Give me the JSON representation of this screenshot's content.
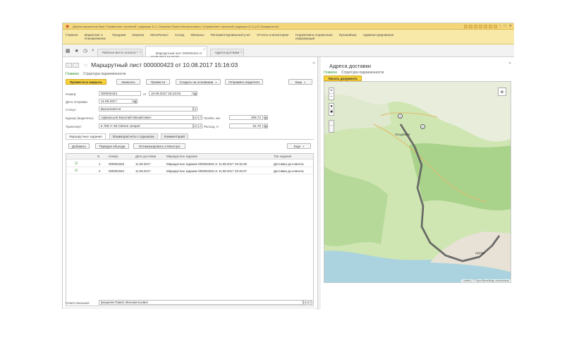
{
  "app": {
    "title": "Демонстрационная база \"Управление торговлей\", редакция 11.1 / Бакшеев Павел Иннокентьевич / (Управление торговлей, редакция 11.1) (1С:Предприятие)"
  },
  "sections": [
    {
      "label": "Главное"
    },
    {
      "label": "Маркетинг и\nпланирование"
    },
    {
      "label": "Продажи"
    },
    {
      "label": "Закупки"
    },
    {
      "label": "МегаПолист"
    },
    {
      "label": "Склад"
    },
    {
      "label": "Финансы"
    },
    {
      "label": "Регламентированный учет"
    },
    {
      "label": "Отчеты и мониторинг"
    },
    {
      "label": "Нормативно-справочная\nинформация"
    },
    {
      "label": "Органайзер"
    },
    {
      "label": "Администрирование"
    }
  ],
  "open_tabs": [
    {
      "label": "Рабочее место логиста *"
    },
    {
      "label": "Маршрутный лист 000000423 от\n10.08.2017 15:16:03"
    },
    {
      "label": "Адреса доставки"
    }
  ],
  "doc": {
    "title": "Маршрутный лист 000000423 от 10.08.2017 15:16:03",
    "link_main": "Главное",
    "link_sub": "Структура подчиненности",
    "buttons": {
      "post_close": "Провести и закрыть",
      "save": "Записать",
      "post": "Провести",
      "create_based": "Создать на основании",
      "send_driver": "Отправить водителя",
      "more": "Еще"
    },
    "fields": {
      "number_label": "Номер:",
      "number_value": "000000423",
      "date_from_label": "от",
      "date_value": "10.08.2017 15:16:03",
      "depart_label": "Дата отправки:",
      "depart_value": "11.08.2017",
      "status_label": "Статус:",
      "status_value": "Выполняется",
      "courier_label": "Курьер (водитель):",
      "courier_value": "Афанасьев Василий Михайлович",
      "mileage_label": "Пробег, км:",
      "mileage_value": "209.74",
      "transport_label": "Транспорт:",
      "transport_value": "в 759 тт 50 Citroen Jumper",
      "fuel_label": "Расход, л:",
      "fuel_value": "91.70",
      "responsible_label": "Ответственный:",
      "responsible_value": "Бакшеев Павел Иннокентьевич"
    },
    "form_tabs": [
      {
        "label": "Маршрутные задания"
      },
      {
        "label": "Взаиморасчеты с курьером"
      },
      {
        "label": "Комментарий"
      }
    ],
    "grid_buttons": {
      "add": "Добавить",
      "order": "Порядок объезда",
      "optimize": "Оптимизировать в Маэстро",
      "more": "Еще"
    },
    "grid": {
      "columns": [
        "N",
        "Номер",
        "Дата доставки",
        "Маршрутное задание",
        "Тип задания"
      ],
      "rows": [
        {
          "n": "1",
          "number": "000002253",
          "date": "11.08.2017",
          "task": "Маршрутное задание 000002253 от 11.08.2017 19:16:35",
          "type": "Доставка до клиента"
        },
        {
          "n": "2",
          "number": "000002254",
          "date": "11.08.2017",
          "task": "Маршрутное задание 000002254 от 11.08.2017 19:15:07",
          "type": "Доставка до клиента"
        }
      ]
    }
  },
  "delivery": {
    "title": "Адреса доставки",
    "link_main": "Главное",
    "link_sub": "Структура подчиненности",
    "print_button": "Печать документа",
    "map": {
      "attribution": "Leaflet | © OpenStreetMap contributors",
      "markers": [
        {
          "label": "1"
        },
        {
          "label": "2"
        }
      ],
      "place_labels": [
        "Уссурийск",
        "Артем"
      ]
    }
  }
}
